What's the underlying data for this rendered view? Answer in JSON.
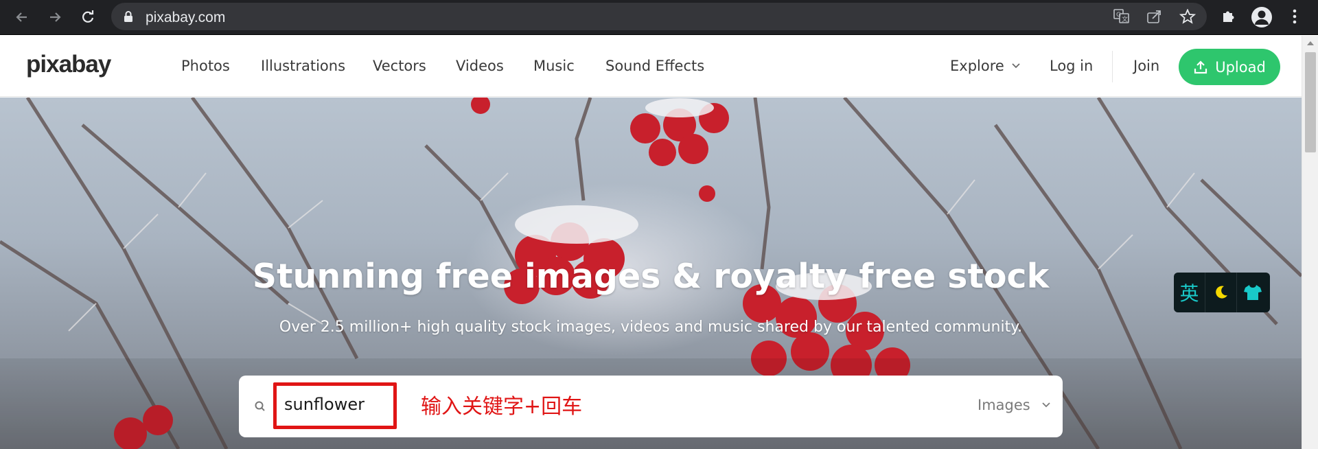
{
  "browser": {
    "url": "pixabay.com",
    "icons": {
      "back": "arrow-left-icon",
      "forward": "arrow-right-icon",
      "reload": "reload-icon",
      "lock": "lock-icon",
      "translate": "translate-icon",
      "share": "share-icon",
      "bookmark": "star-icon",
      "extensions": "puzzle-icon",
      "profile": "profile-icon",
      "menu": "kebab-menu-icon"
    }
  },
  "header": {
    "logo": "pixabay",
    "nav": [
      "Photos",
      "Illustrations",
      "Vectors",
      "Videos",
      "Music",
      "Sound Effects"
    ],
    "explore_label": "Explore",
    "login_label": "Log in",
    "join_label": "Join",
    "upload_label": "Upload"
  },
  "hero": {
    "title": "Stunning free images & royalty free stock",
    "subtitle": "Over 2.5 million+ high quality stock images, videos and music shared by our talented community."
  },
  "search": {
    "value": "sunflower",
    "annotation": "输入关键字+回车",
    "type_selected": "Images"
  },
  "widget": {
    "lang_label": "英",
    "icons": [
      "moon-icon",
      "tshirt-icon"
    ]
  },
  "colors": {
    "chrome_bg": "#202124",
    "upload_green": "#2ec66d",
    "annotation_red": "#e01515",
    "widget_bg": "#0d1b1e",
    "widget_accent": "#19c9c9"
  }
}
